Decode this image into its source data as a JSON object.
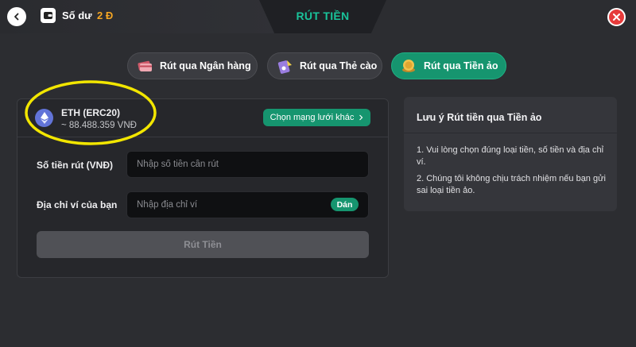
{
  "header": {
    "balance_label": "Số dư",
    "balance_value": "2 Đ",
    "title": "RÚT TIỀN"
  },
  "tabs": [
    {
      "label": "Rút qua Ngân hàng",
      "icon": "bank-card-icon",
      "active": false
    },
    {
      "label": "Rút qua Thẻ cào",
      "icon": "scratch-card-icon",
      "active": false
    },
    {
      "label": "Rút qua Tiền ảo",
      "icon": "crypto-coin-icon",
      "active": true
    }
  ],
  "coin": {
    "name": "ETH (ERC20)",
    "rate": "~ 88.488.359 VNĐ",
    "icon": "ethereum-icon",
    "change_network_label": "Chọn mạng lưới khác"
  },
  "form": {
    "amount_label": "Số tiền rút (VNĐ)",
    "amount_placeholder": "Nhập số tiền cần rút",
    "address_label": "Địa chỉ ví của bạn",
    "address_placeholder": "Nhập địa chỉ ví",
    "paste_label": "Dán",
    "submit_label": "Rút Tiền"
  },
  "note": {
    "title": "Lưu ý Rút tiền qua Tiền ảo",
    "items": [
      "1. Vui lòng chọn đúng loại tiền, số tiền và địa chỉ ví.",
      "2. Chúng tôi không chịu trách nhiệm nếu bạn gửi sai loại tiền ảo."
    ]
  },
  "colors": {
    "background": "#2c2d31",
    "accent_green": "#16956f",
    "title_green": "#19c39a",
    "balance_orange": "#f5a623",
    "close_red": "#e63b3b",
    "highlight_yellow": "#f2e600"
  }
}
